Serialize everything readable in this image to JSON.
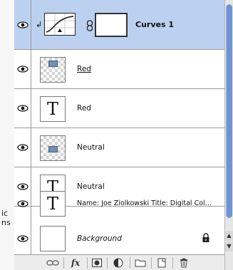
{
  "left_fragments": [
    "ic",
    "ns"
  ],
  "layers": [
    {
      "name": "Curves 1",
      "kind": "curves",
      "selected": true
    },
    {
      "name": "Red",
      "kind": "image",
      "underline": true
    },
    {
      "name": "Red",
      "kind": "text"
    },
    {
      "name": "Neutral",
      "kind": "image"
    },
    {
      "name": "Neutral",
      "kind": "text"
    },
    {
      "name": "Name: Joe Ziolkowski Title: Digital Col...",
      "kind": "text"
    },
    {
      "name": "Background",
      "kind": "background",
      "italic": true,
      "locked": true
    }
  ],
  "thumb_text_glyph": "T",
  "toolbar": {
    "buttons": [
      "link-layers-icon",
      "fx-icon",
      "add-mask-icon",
      "adjustment-layer-icon",
      "new-group-icon",
      "new-layer-icon",
      "trash-icon"
    ],
    "fx_label": "fx"
  },
  "colors": {
    "selected_row": "#bcd0f0",
    "scroll_thumb": "#6f94d0"
  }
}
